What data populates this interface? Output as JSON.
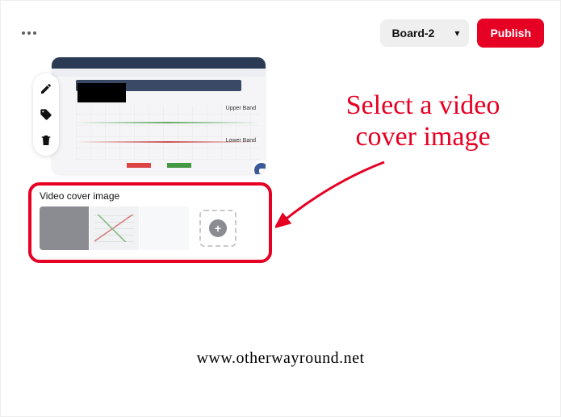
{
  "topbar": {
    "board_selected": "Board-2",
    "publish_label": "Publish"
  },
  "preview": {
    "label_upper": "Upper Band",
    "label_lower": "Lower Band"
  },
  "cover": {
    "section_label": "Video cover image"
  },
  "annotation": {
    "text": "Select a video cover image"
  },
  "watermark": "www.otherwayround.net"
}
